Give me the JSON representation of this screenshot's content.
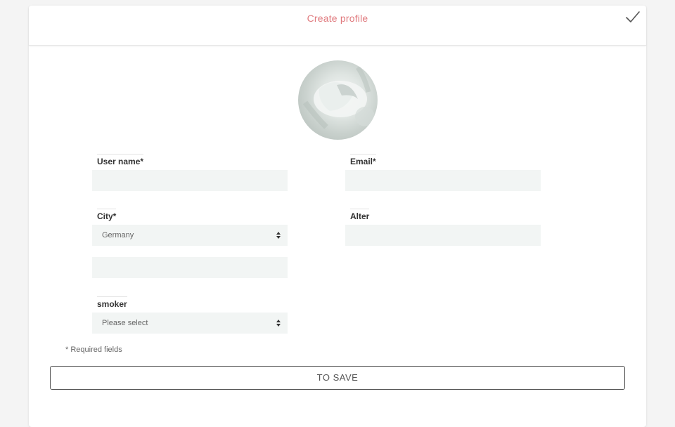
{
  "header": {
    "title": "Create profile"
  },
  "form": {
    "username_label": "User name*",
    "username_value": "",
    "email_label": "Email*",
    "email_value": "",
    "city_label": "City*",
    "city_selected": "Germany",
    "city_extra_value": "",
    "age_label": "Alter",
    "age_value": "",
    "smoker_label": "smoker",
    "smoker_selected": "Please select",
    "required_note": "* Required fields",
    "save_label": "TO SAVE"
  },
  "colors": {
    "title": "#e07a7e",
    "field_bg": "#f2f5f4"
  },
  "icons": {
    "confirm": "checkmark-icon",
    "select": "sort-arrows-icon"
  }
}
